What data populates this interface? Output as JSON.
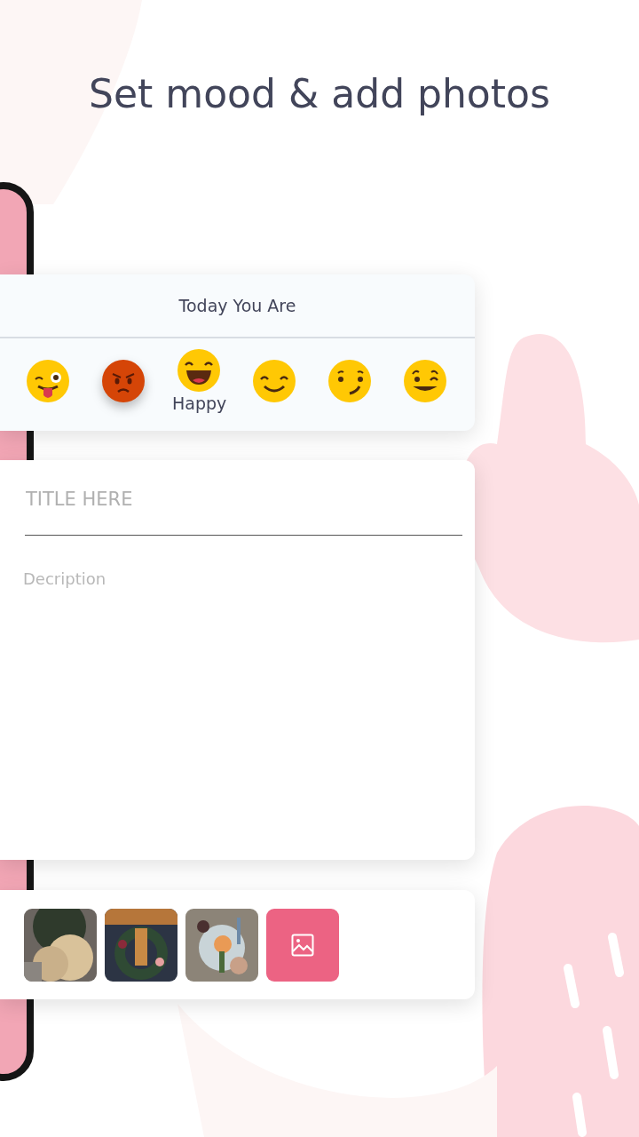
{
  "headline": "Set mood & add photos",
  "mood_card": {
    "title": "Today You Are",
    "moods": [
      {
        "kind": "tongue",
        "selected": false
      },
      {
        "kind": "angry",
        "selected": false
      },
      {
        "kind": "laugh",
        "selected": true,
        "label": "Happy"
      },
      {
        "kind": "smile",
        "selected": false
      },
      {
        "kind": "smirk",
        "selected": false
      },
      {
        "kind": "wink",
        "selected": false
      }
    ]
  },
  "entry_card": {
    "title_field": {
      "placeholder": "TITLE HERE"
    },
    "description_field": {
      "placeholder": "Decription"
    }
  },
  "photos_card": {
    "add_button": {
      "kind": "add-image"
    }
  }
}
